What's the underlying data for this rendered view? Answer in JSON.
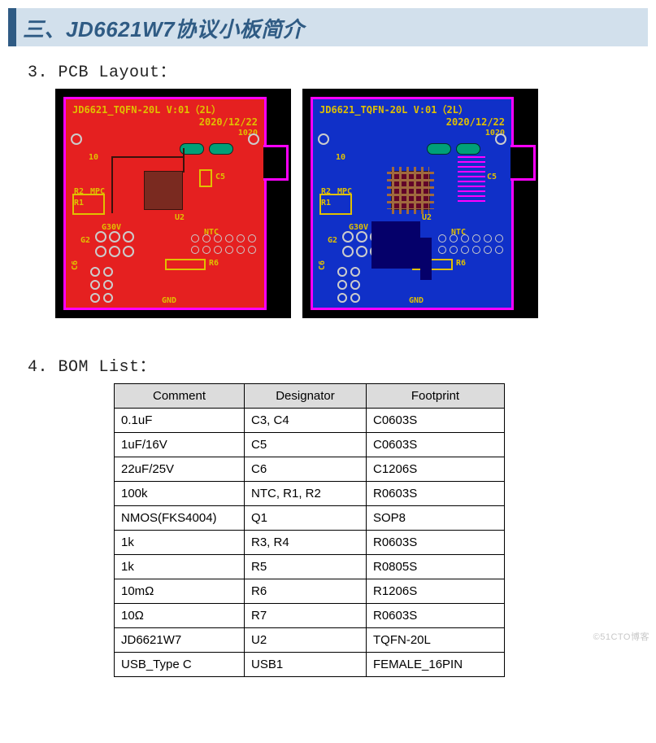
{
  "header": {
    "title": "三、JD6621W7协议小板简介"
  },
  "sections": {
    "pcb_label": "3.  PCB  Layout：",
    "bom_label": "4.  BOM  List："
  },
  "pcb": {
    "title_line1": "JD6621_TQFN-20L V:01（2L）",
    "title_line2": "2020/12/22",
    "labels": {
      "r2": "R2",
      "mpc": "MPC",
      "r1": "R1",
      "g30v": "G30V",
      "u2": "U2",
      "g2": "G2",
      "ntc": "NTC",
      "r6": "R6",
      "c5": "C5",
      "c6": "C6",
      "gnd": "GND",
      "ten": "10",
      "dtop": "1020"
    }
  },
  "bom": {
    "headers": [
      "Comment",
      "Designator",
      "Footprint"
    ],
    "rows": [
      [
        "0.1uF",
        "C3, C4",
        "C0603S"
      ],
      [
        "1uF/16V",
        "C5",
        "C0603S"
      ],
      [
        "22uF/25V",
        "C6",
        "C1206S"
      ],
      [
        "100k",
        "NTC, R1, R2",
        "R0603S"
      ],
      [
        "NMOS(FKS4004)",
        "Q1",
        "SOP8"
      ],
      [
        "1k",
        "R3, R4",
        "R0603S"
      ],
      [
        "1k",
        "R5",
        "R0805S"
      ],
      [
        "10mΩ",
        "R6",
        "R1206S"
      ],
      [
        "10Ω",
        "R7",
        "R0603S"
      ],
      [
        "JD6621W7",
        "U2",
        "TQFN-20L"
      ],
      [
        "USB_Type C",
        "USB1",
        "FEMALE_16PIN"
      ]
    ]
  },
  "watermark": "©51CTO博客"
}
